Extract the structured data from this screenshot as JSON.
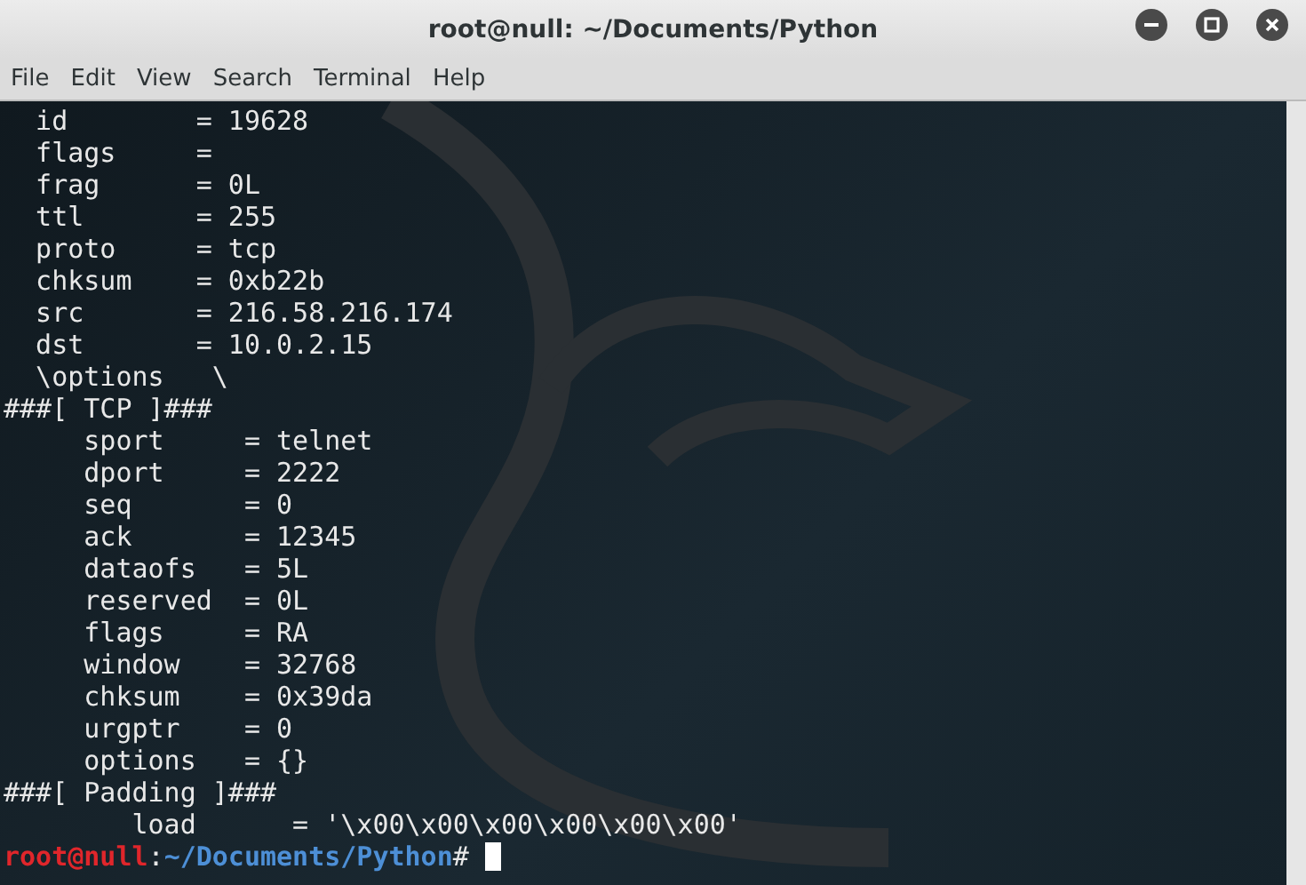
{
  "window": {
    "title": "root@null: ~/Documents/Python"
  },
  "menu": [
    "File",
    "Edit",
    "View",
    "Search",
    "Terminal",
    "Help"
  ],
  "terminal": {
    "lines": [
      {
        "kind": "text",
        "text": "  id        = 19628"
      },
      {
        "kind": "text",
        "text": "  flags     = "
      },
      {
        "kind": "text",
        "text": "  frag      = 0L"
      },
      {
        "kind": "text",
        "text": "  ttl       = 255"
      },
      {
        "kind": "text",
        "text": "  proto     = tcp"
      },
      {
        "kind": "text",
        "text": "  chksum    = 0xb22b"
      },
      {
        "kind": "text",
        "text": "  src       = 216.58.216.174"
      },
      {
        "kind": "text",
        "text": "  dst       = 10.0.2.15"
      },
      {
        "kind": "text",
        "text": "  \\options   \\"
      },
      {
        "kind": "text",
        "text": "###[ TCP ]###"
      },
      {
        "kind": "text",
        "text": "     sport     = telnet"
      },
      {
        "kind": "text",
        "text": "     dport     = 2222"
      },
      {
        "kind": "text",
        "text": "     seq       = 0"
      },
      {
        "kind": "text",
        "text": "     ack       = 12345"
      },
      {
        "kind": "text",
        "text": "     dataofs   = 5L"
      },
      {
        "kind": "text",
        "text": "     reserved  = 0L"
      },
      {
        "kind": "text",
        "text": "     flags     = RA"
      },
      {
        "kind": "text",
        "text": "     window    = 32768"
      },
      {
        "kind": "text",
        "text": "     chksum    = 0x39da"
      },
      {
        "kind": "text",
        "text": "     urgptr    = 0"
      },
      {
        "kind": "text",
        "text": "     options   = {}"
      },
      {
        "kind": "text",
        "text": "###[ Padding ]###"
      },
      {
        "kind": "text",
        "text": "        load      = '\\x00\\x00\\x00\\x00\\x00\\x00'"
      },
      {
        "kind": "prompt",
        "user_host": "root@null",
        "separator": ":",
        "path": "~/Documents/Python",
        "symbol": "# "
      }
    ]
  }
}
